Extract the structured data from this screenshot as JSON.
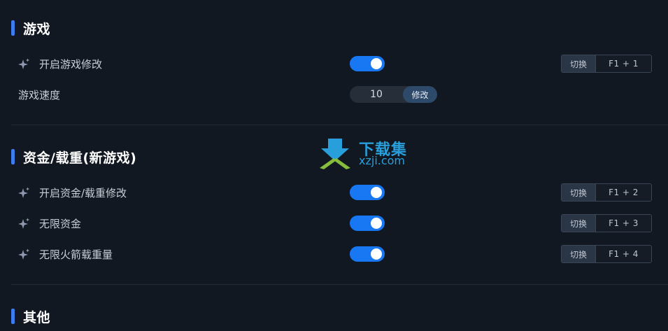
{
  "sections": [
    {
      "title": "游戏",
      "rows": [
        {
          "label": "开启游戏修改",
          "type": "toggle",
          "enabled": true,
          "hotkey_action": "切换",
          "hotkey_keys": "F1 + 1"
        },
        {
          "label": "游戏速度",
          "type": "stepper",
          "value": "10",
          "button": "修改"
        }
      ]
    },
    {
      "title": "资金/载重(新游戏)",
      "rows": [
        {
          "label": "开启资金/载重修改",
          "type": "toggle",
          "enabled": true,
          "hotkey_action": "切换",
          "hotkey_keys": "F1 + 2"
        },
        {
          "label": "无限资金",
          "type": "toggle",
          "enabled": true,
          "hotkey_action": "切换",
          "hotkey_keys": "F1 + 3"
        },
        {
          "label": "无限火箭载重量",
          "type": "toggle",
          "enabled": true,
          "hotkey_action": "切换",
          "hotkey_keys": "F1 + 4"
        }
      ]
    },
    {
      "title": "其他",
      "rows": []
    }
  ],
  "watermark": {
    "title": "下载集",
    "url": "xzji.com"
  },
  "colors": {
    "background": "#111821",
    "accent": "#3d7cf0",
    "toggle_on": "#1877f2",
    "watermark": "#2aa7e6"
  },
  "icons": {
    "row_icon": "sparkle-icon"
  }
}
